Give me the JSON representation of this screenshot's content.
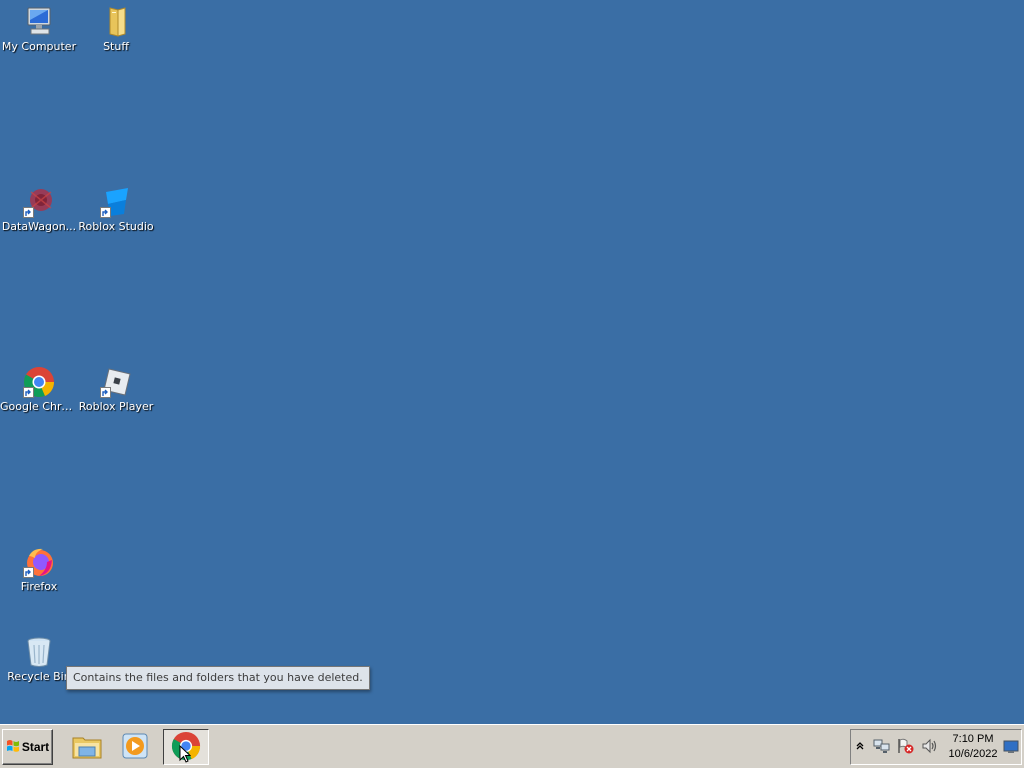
{
  "desktop": {
    "background_color": "#3a6ea5",
    "icons": [
      {
        "label": "My Computer",
        "icon": "computer-icon"
      },
      {
        "label": "Stuff",
        "icon": "folder-icon"
      },
      {
        "label": "DataWagon...",
        "icon": "datawagon-icon"
      },
      {
        "label": "Roblox Studio",
        "icon": "roblox-studio-icon"
      },
      {
        "label": "Google Chrome",
        "icon": "chrome-icon"
      },
      {
        "label": "Roblox Player",
        "icon": "roblox-player-icon"
      },
      {
        "label": "Firefox",
        "icon": "firefox-icon"
      },
      {
        "label": "Recycle Bin",
        "icon": "recycle-bin-icon"
      }
    ]
  },
  "tooltip": {
    "text": "Contains the files and folders that you have deleted."
  },
  "taskbar": {
    "start_label": "Start",
    "pinned": [
      {
        "icon": "file-explorer-icon"
      },
      {
        "icon": "media-player-icon"
      },
      {
        "icon": "chrome-icon",
        "active": true
      }
    ],
    "tray": {
      "icons": [
        "show-hidden-icons-chevron",
        "network-icon",
        "action-center-flag-icon",
        "volume-icon"
      ],
      "time": "7:10 PM",
      "date": "10/6/2022"
    }
  }
}
